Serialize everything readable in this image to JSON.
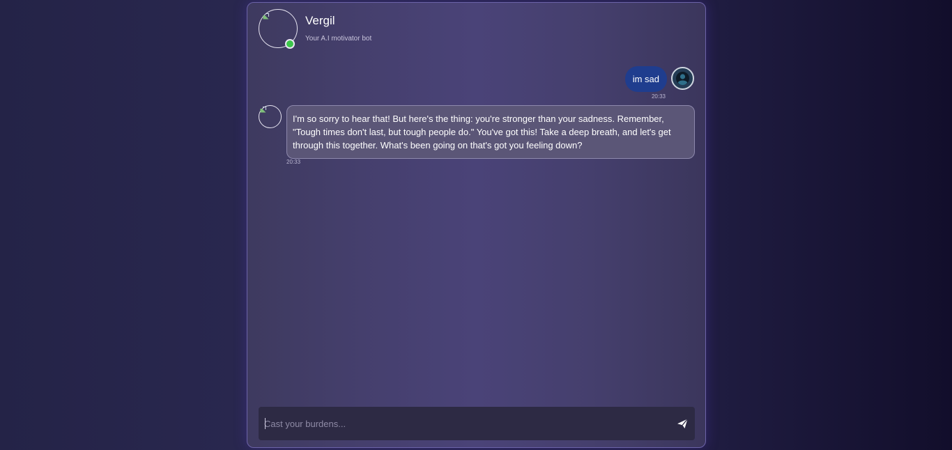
{
  "header": {
    "bot_name": "Vergil",
    "tagline": "Your A.I motivator bot"
  },
  "messages": [
    {
      "sender": "user",
      "text": "im sad",
      "time": "20:33"
    },
    {
      "sender": "bot",
      "text": "I'm so sorry to hear that! But here's the thing: you're stronger than your sadness. Remember, \"Tough times don't last, but tough people do.\" You've got this! Take a deep breath, and let's get through this together. What's been going on that's got you feeling down?",
      "time": "20:33"
    }
  ],
  "composer": {
    "placeholder": "Cast your burdens...",
    "value": ""
  },
  "icons": {
    "send": "send-icon",
    "user_avatar": "user-avatar-icon",
    "status": "online-status-icon"
  },
  "colors": {
    "user_bubble": "#1f3d8e",
    "online": "#3cc64a",
    "panel_border": "#6c63a8"
  }
}
